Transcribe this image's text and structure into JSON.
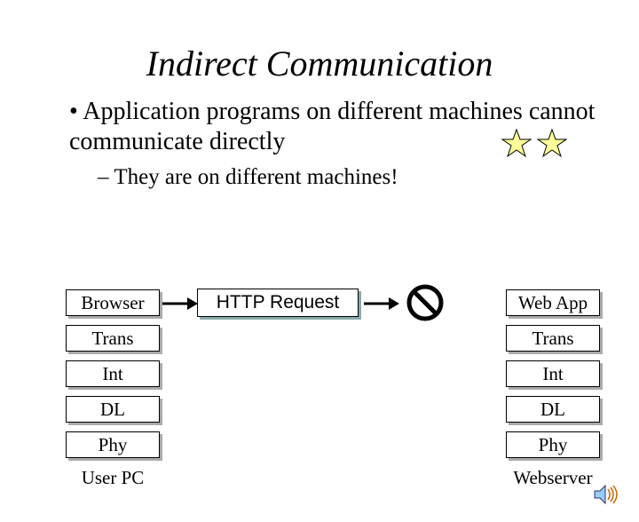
{
  "title": "Indirect Communication",
  "bullet": "Application programs on different machines cannot communicate directly",
  "subbullet": "They are on different machines!",
  "request_label": "HTTP Request",
  "left_stack": {
    "layers": [
      "Browser",
      "Trans",
      "Int",
      "DL",
      "Phy"
    ],
    "label": "User PC"
  },
  "right_stack": {
    "layers": [
      "Web App",
      "Trans",
      "Int",
      "DL",
      "Phy"
    ],
    "label": "Webserver"
  }
}
